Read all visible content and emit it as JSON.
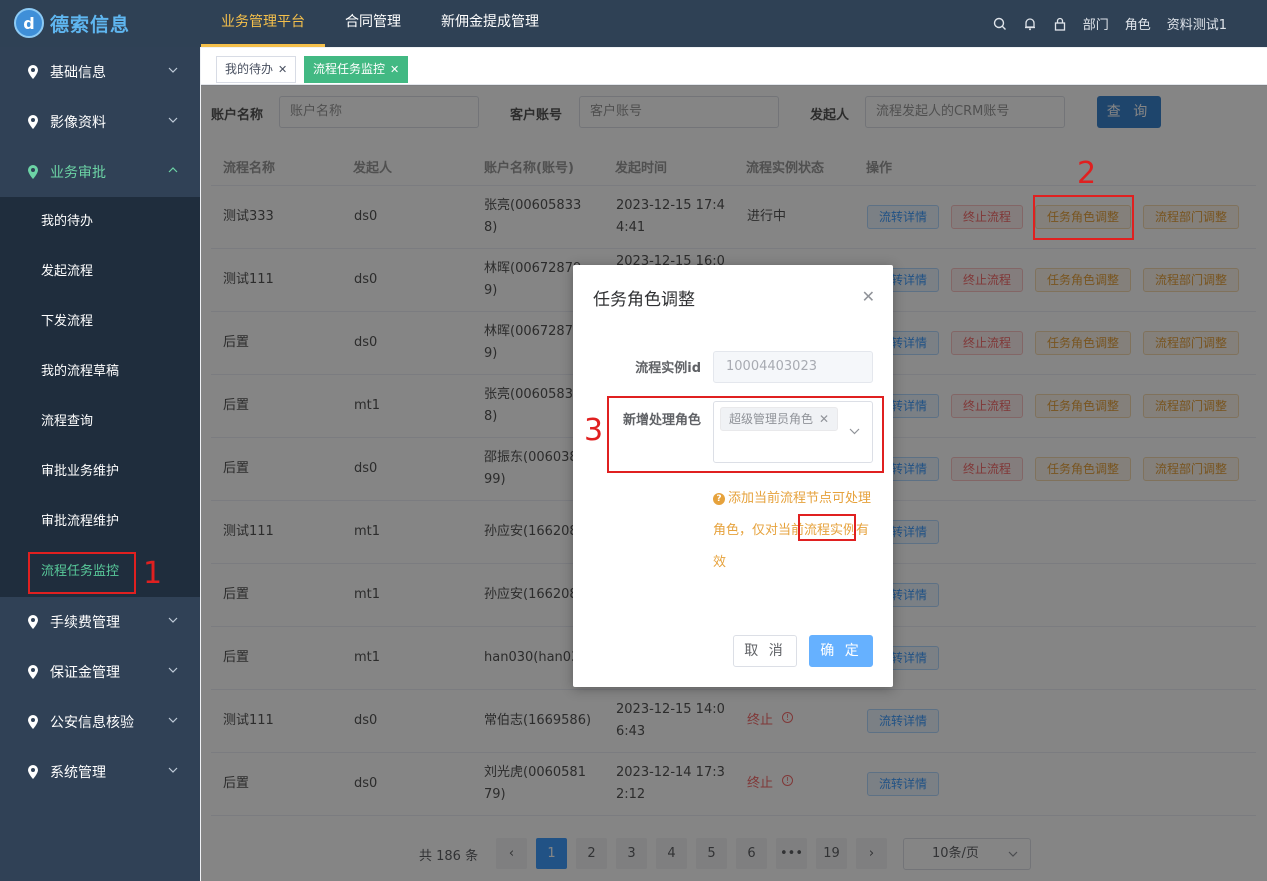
{
  "header": {
    "logo_mark": "d",
    "logo_text": "德索信息",
    "nav": [
      "业务管理平台",
      "合同管理",
      "新佣金提成管理"
    ],
    "right": {
      "dept": "部门",
      "role": "角色",
      "user": "资料测试1"
    }
  },
  "sidebar": {
    "groups_top": [
      "基础信息",
      "影像资料",
      "业务审批"
    ],
    "sub_items": [
      "我的待办",
      "发起流程",
      "下发流程",
      "我的流程草稿",
      "流程查询",
      "审批业务维护",
      "审批流程维护",
      "流程任务监控"
    ],
    "groups_bottom": [
      "手续费管理",
      "保证金管理",
      "公安信息核验",
      "系统管理"
    ]
  },
  "tags": [
    {
      "label": "我的待办"
    },
    {
      "label": "流程任务监控"
    }
  ],
  "filters": {
    "account_name_label": "账户名称",
    "account_name_placeholder": "账户名称",
    "account_no_label": "客户账号",
    "account_no_placeholder": "客户账号",
    "initiator_label": "发起人",
    "initiator_placeholder": "流程发起人的CRM账号",
    "query_label": "查 询"
  },
  "table": {
    "headers": [
      "流程名称",
      "发起人",
      "账户名称(账号)",
      "发起时间",
      "流程实例状态",
      "操作"
    ],
    "ops": {
      "detail": "流转详情",
      "stop": "终止流程",
      "role": "任务角色调整",
      "dept": "流程部门调整"
    },
    "rows": [
      {
        "name": "测试333",
        "initiator": "ds0",
        "account": [
          "张亮(00605833",
          "8)"
        ],
        "time": [
          "2023-12-15 17:4",
          "4:41"
        ],
        "status": "进行中",
        "ops": "full"
      },
      {
        "name": "测试111",
        "initiator": "ds0",
        "account": [
          "林晖(00672879",
          "9)"
        ],
        "time": [
          "2023-12-15 16:0",
          ""
        ],
        "status": "",
        "ops": "full"
      },
      {
        "name": "后置",
        "initiator": "ds0",
        "account": [
          "林晖(00672879",
          "9)"
        ],
        "time": [
          "",
          ""
        ],
        "status": "",
        "ops": "full"
      },
      {
        "name": "后置",
        "initiator": "mt1",
        "account": [
          "张亮(00605833",
          "8)"
        ],
        "time": [
          "",
          ""
        ],
        "status": "",
        "ops": "full"
      },
      {
        "name": "后置",
        "initiator": "ds0",
        "account": [
          "邵振东(006038",
          "99)"
        ],
        "time": [
          "",
          ""
        ],
        "status": "",
        "ops": "full"
      },
      {
        "name": "测试111",
        "initiator": "mt1",
        "account": [
          "孙应安(166208",
          ""
        ],
        "time": [
          "",
          ""
        ],
        "status": "",
        "ops": "detail"
      },
      {
        "name": "后置",
        "initiator": "mt1",
        "account": [
          "孙应安(166208",
          ""
        ],
        "time": [
          "",
          ""
        ],
        "status": "",
        "ops": "detail"
      },
      {
        "name": "后置",
        "initiator": "mt1",
        "account": [
          "han030(han03",
          ""
        ],
        "time": [
          "",
          ""
        ],
        "status": "",
        "ops": "detail"
      },
      {
        "name": "测试111",
        "initiator": "ds0",
        "account": [
          "常伯志(1669586)",
          ""
        ],
        "time": [
          "2023-12-15 14:0",
          "6:43"
        ],
        "status": "终止",
        "ops": "detail"
      },
      {
        "name": "后置",
        "initiator": "ds0",
        "account": [
          "刘光虎(0060581",
          "79)"
        ],
        "time": [
          "2023-12-14 17:3",
          "2:12"
        ],
        "status": "终止",
        "ops": "detail"
      }
    ]
  },
  "pagination": {
    "total": "共 186 条",
    "pages": [
      "1",
      "2",
      "3",
      "4",
      "5",
      "6",
      "•••",
      "19"
    ],
    "active": "1",
    "size": "10条/页"
  },
  "dialog": {
    "title": "任务角色调整",
    "instance_label": "流程实例id",
    "instance_value": "10004403023",
    "role_label": "新增处理角色",
    "role_chip": "超级管理员角色",
    "tip": "添加当前流程节点可处理角色，仅对当前流程实例有效",
    "cancel": "取 消",
    "ok": "确 定"
  },
  "annotations": [
    "1",
    "2",
    "3"
  ],
  "colors": {
    "header": "#2f4155",
    "sidebar": "#304156",
    "accent_green": "#42b983",
    "primary": "#409eff",
    "annotation": "#e02020"
  }
}
